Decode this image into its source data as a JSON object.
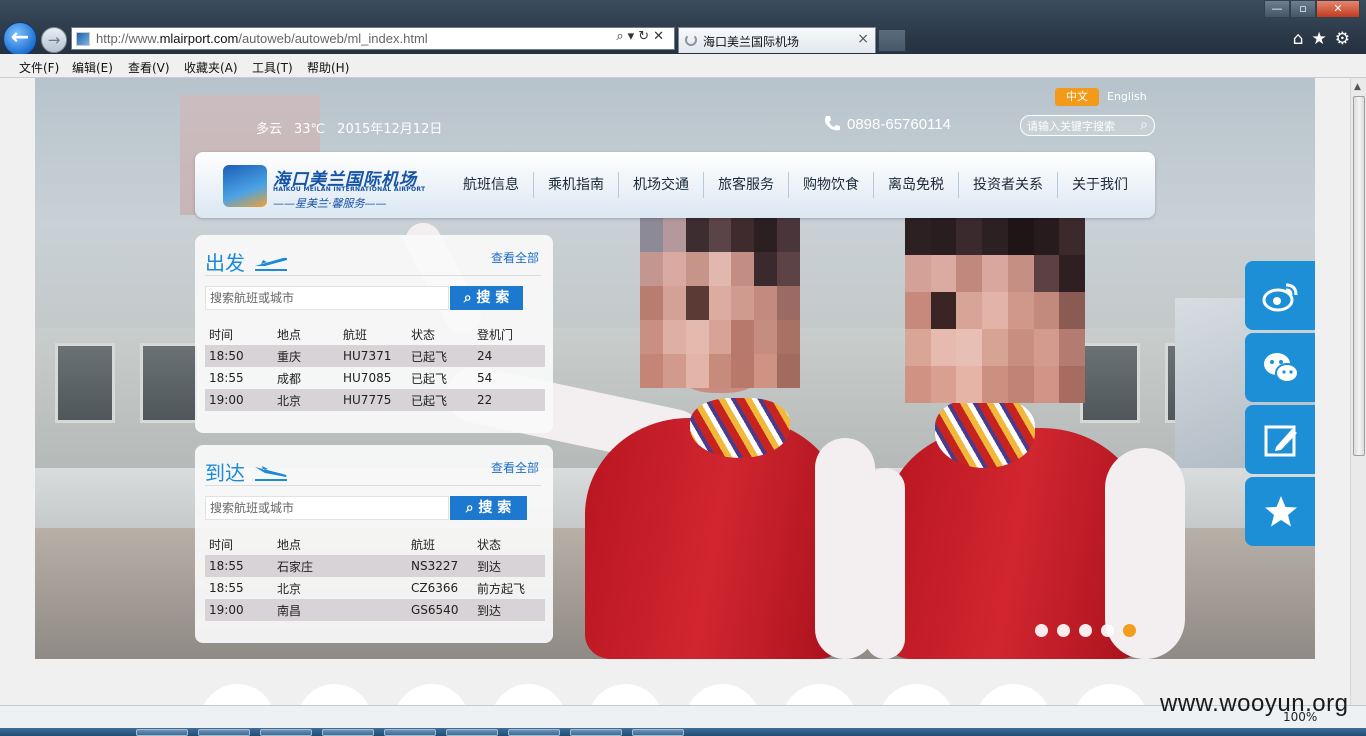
{
  "browser": {
    "url_prefix": "http://www.",
    "url_domain": "mlairport.com",
    "url_path": "/autoweb/autoweb/ml_index.html",
    "tab_title": "海口美兰国际机场",
    "address_tools": "⌕▾↻✕",
    "tab_close": "×",
    "back_glyph": "←",
    "forward_glyph": "→",
    "window": {
      "minimize": "—",
      "maximize": "▫",
      "close": "✕"
    },
    "right_tools": "⌂★⚙",
    "menu": [
      "文件(F)",
      "编辑(E)",
      "查看(V)",
      "收藏夹(A)",
      "工具(T)",
      "帮助(H)"
    ],
    "zoom": "100%"
  },
  "header": {
    "weather": "多云",
    "temperature": "33℃",
    "date": "2015年12月12日",
    "lang_cn": "中文",
    "lang_en": "English",
    "phone": "0898-65760114",
    "search_placeholder": "请输入关键字搜索",
    "search_icon": "search-icon"
  },
  "logo": {
    "name": "海口美兰国际机场",
    "en_name": "HAIKOU MEILAN INTERNATIONAL AIRPORT",
    "slogan": "——星美兰·馨服务——"
  },
  "nav": [
    "航班信息",
    "乘机指南",
    "机场交通",
    "旅客服务",
    "购物饮食",
    "离岛免税",
    "投资者关系",
    "关于我们"
  ],
  "departure": {
    "title": "出发",
    "more": "查看全部",
    "search_placeholder": "搜索航班或城市",
    "search_button": "搜 索",
    "columns": [
      "时间",
      "地点",
      "航班",
      "状态",
      "登机门"
    ],
    "rows": [
      [
        "18:50",
        "重庆",
        "HU7371",
        "已起飞",
        "24"
      ],
      [
        "18:55",
        "成都",
        "HU7085",
        "已起飞",
        "54"
      ],
      [
        "19:00",
        "北京",
        "HU7775",
        "已起飞",
        "22"
      ]
    ]
  },
  "arrival": {
    "title": "到达",
    "more": "查看全部",
    "search_placeholder": "搜索航班或城市",
    "search_button": "搜 索",
    "columns": [
      "时间",
      "地点",
      "航班",
      "状态"
    ],
    "rows": [
      [
        "18:55",
        "石家庄",
        "NS3227",
        "到达"
      ],
      [
        "18:55",
        "北京",
        "CZ6366",
        "前方起飞"
      ],
      [
        "19:00",
        "南昌",
        "GS6540",
        "到达"
      ]
    ]
  },
  "carousel": {
    "count": 5,
    "active_index": 4
  },
  "social": [
    "weibo-icon",
    "wechat-icon",
    "feedback-icon",
    "favorite-icon"
  ],
  "watermark": "www.wooyun.org",
  "colors": {
    "accent": "#1d78cf",
    "lang_active": "#f39a1b",
    "carousel_active": "#f29d1b",
    "title_blue": "#1d8ad6"
  }
}
